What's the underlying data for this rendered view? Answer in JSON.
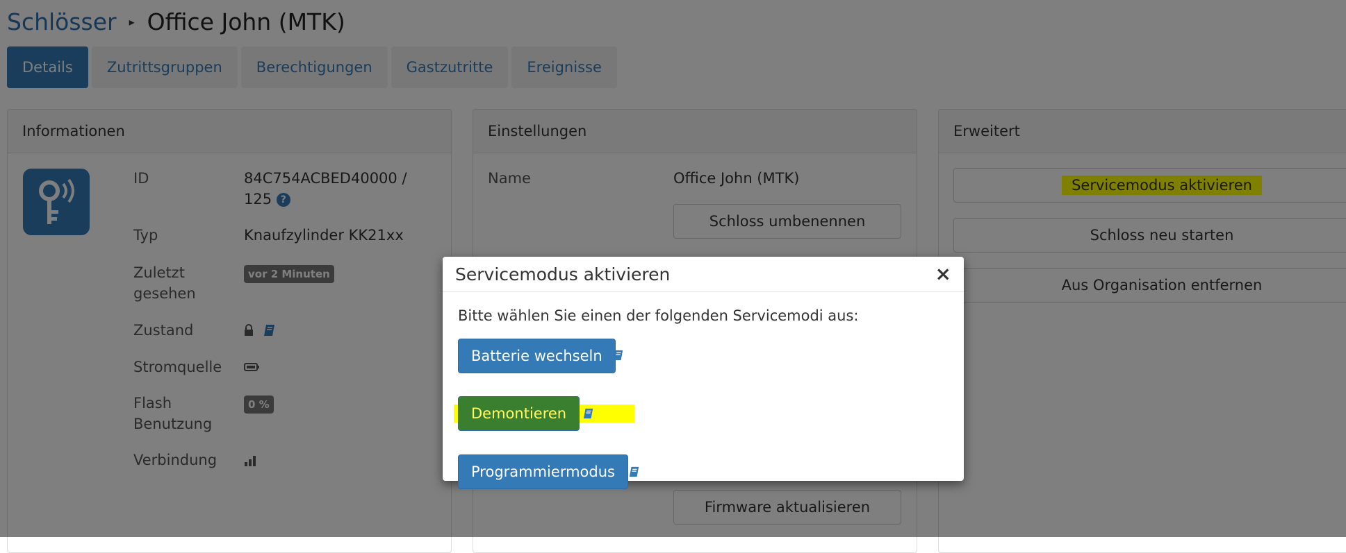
{
  "breadcrumb": {
    "parent": "Schlösser",
    "current": "Office John (MTK)"
  },
  "tabs": [
    {
      "label": "Details",
      "active": true
    },
    {
      "label": "Zutrittsgruppen"
    },
    {
      "label": "Berechtigungen"
    },
    {
      "label": "Gastzutritte"
    },
    {
      "label": "Ereignisse"
    }
  ],
  "info": {
    "title": "Informationen",
    "icon": "key-wireless-icon",
    "rows": [
      {
        "label": "ID",
        "value": "84C754ACBED40000 / 125"
      },
      {
        "label": "Typ",
        "value": "Knaufzylinder KK21xx"
      },
      {
        "label": "Zuletzt gesehen",
        "value": "vor 2 Minuten"
      },
      {
        "label": "Zustand",
        "value": ""
      },
      {
        "label": "Stromquelle",
        "value": ""
      },
      {
        "label": "Flash Benutzung",
        "value": "0 %"
      },
      {
        "label": "Verbindung",
        "value": ""
      }
    ]
  },
  "settings": {
    "title": "Einstellungen",
    "name_label": "Name",
    "name_value": "Office John (MTK)",
    "rename_button": "Schloss umbenennen",
    "firmware_button": "Firmware aktualisieren"
  },
  "advanced": {
    "title": "Erweitert",
    "buttons": [
      "Servicemodus aktivieren",
      "Schloss neu starten",
      "Aus Organisation entfernen"
    ]
  },
  "modal": {
    "title": "Servicemodus aktivieren",
    "close": "×",
    "text": "Bitte wählen Sie einen der folgenden Servicemodi aus:",
    "options": [
      "Batterie wechseln",
      "Demontieren",
      "Programmiermodus"
    ]
  },
  "colors": {
    "primary": "#337ab7",
    "highlight": "#ffff00",
    "overlay": "rgba(0,0,0,0.5)"
  }
}
